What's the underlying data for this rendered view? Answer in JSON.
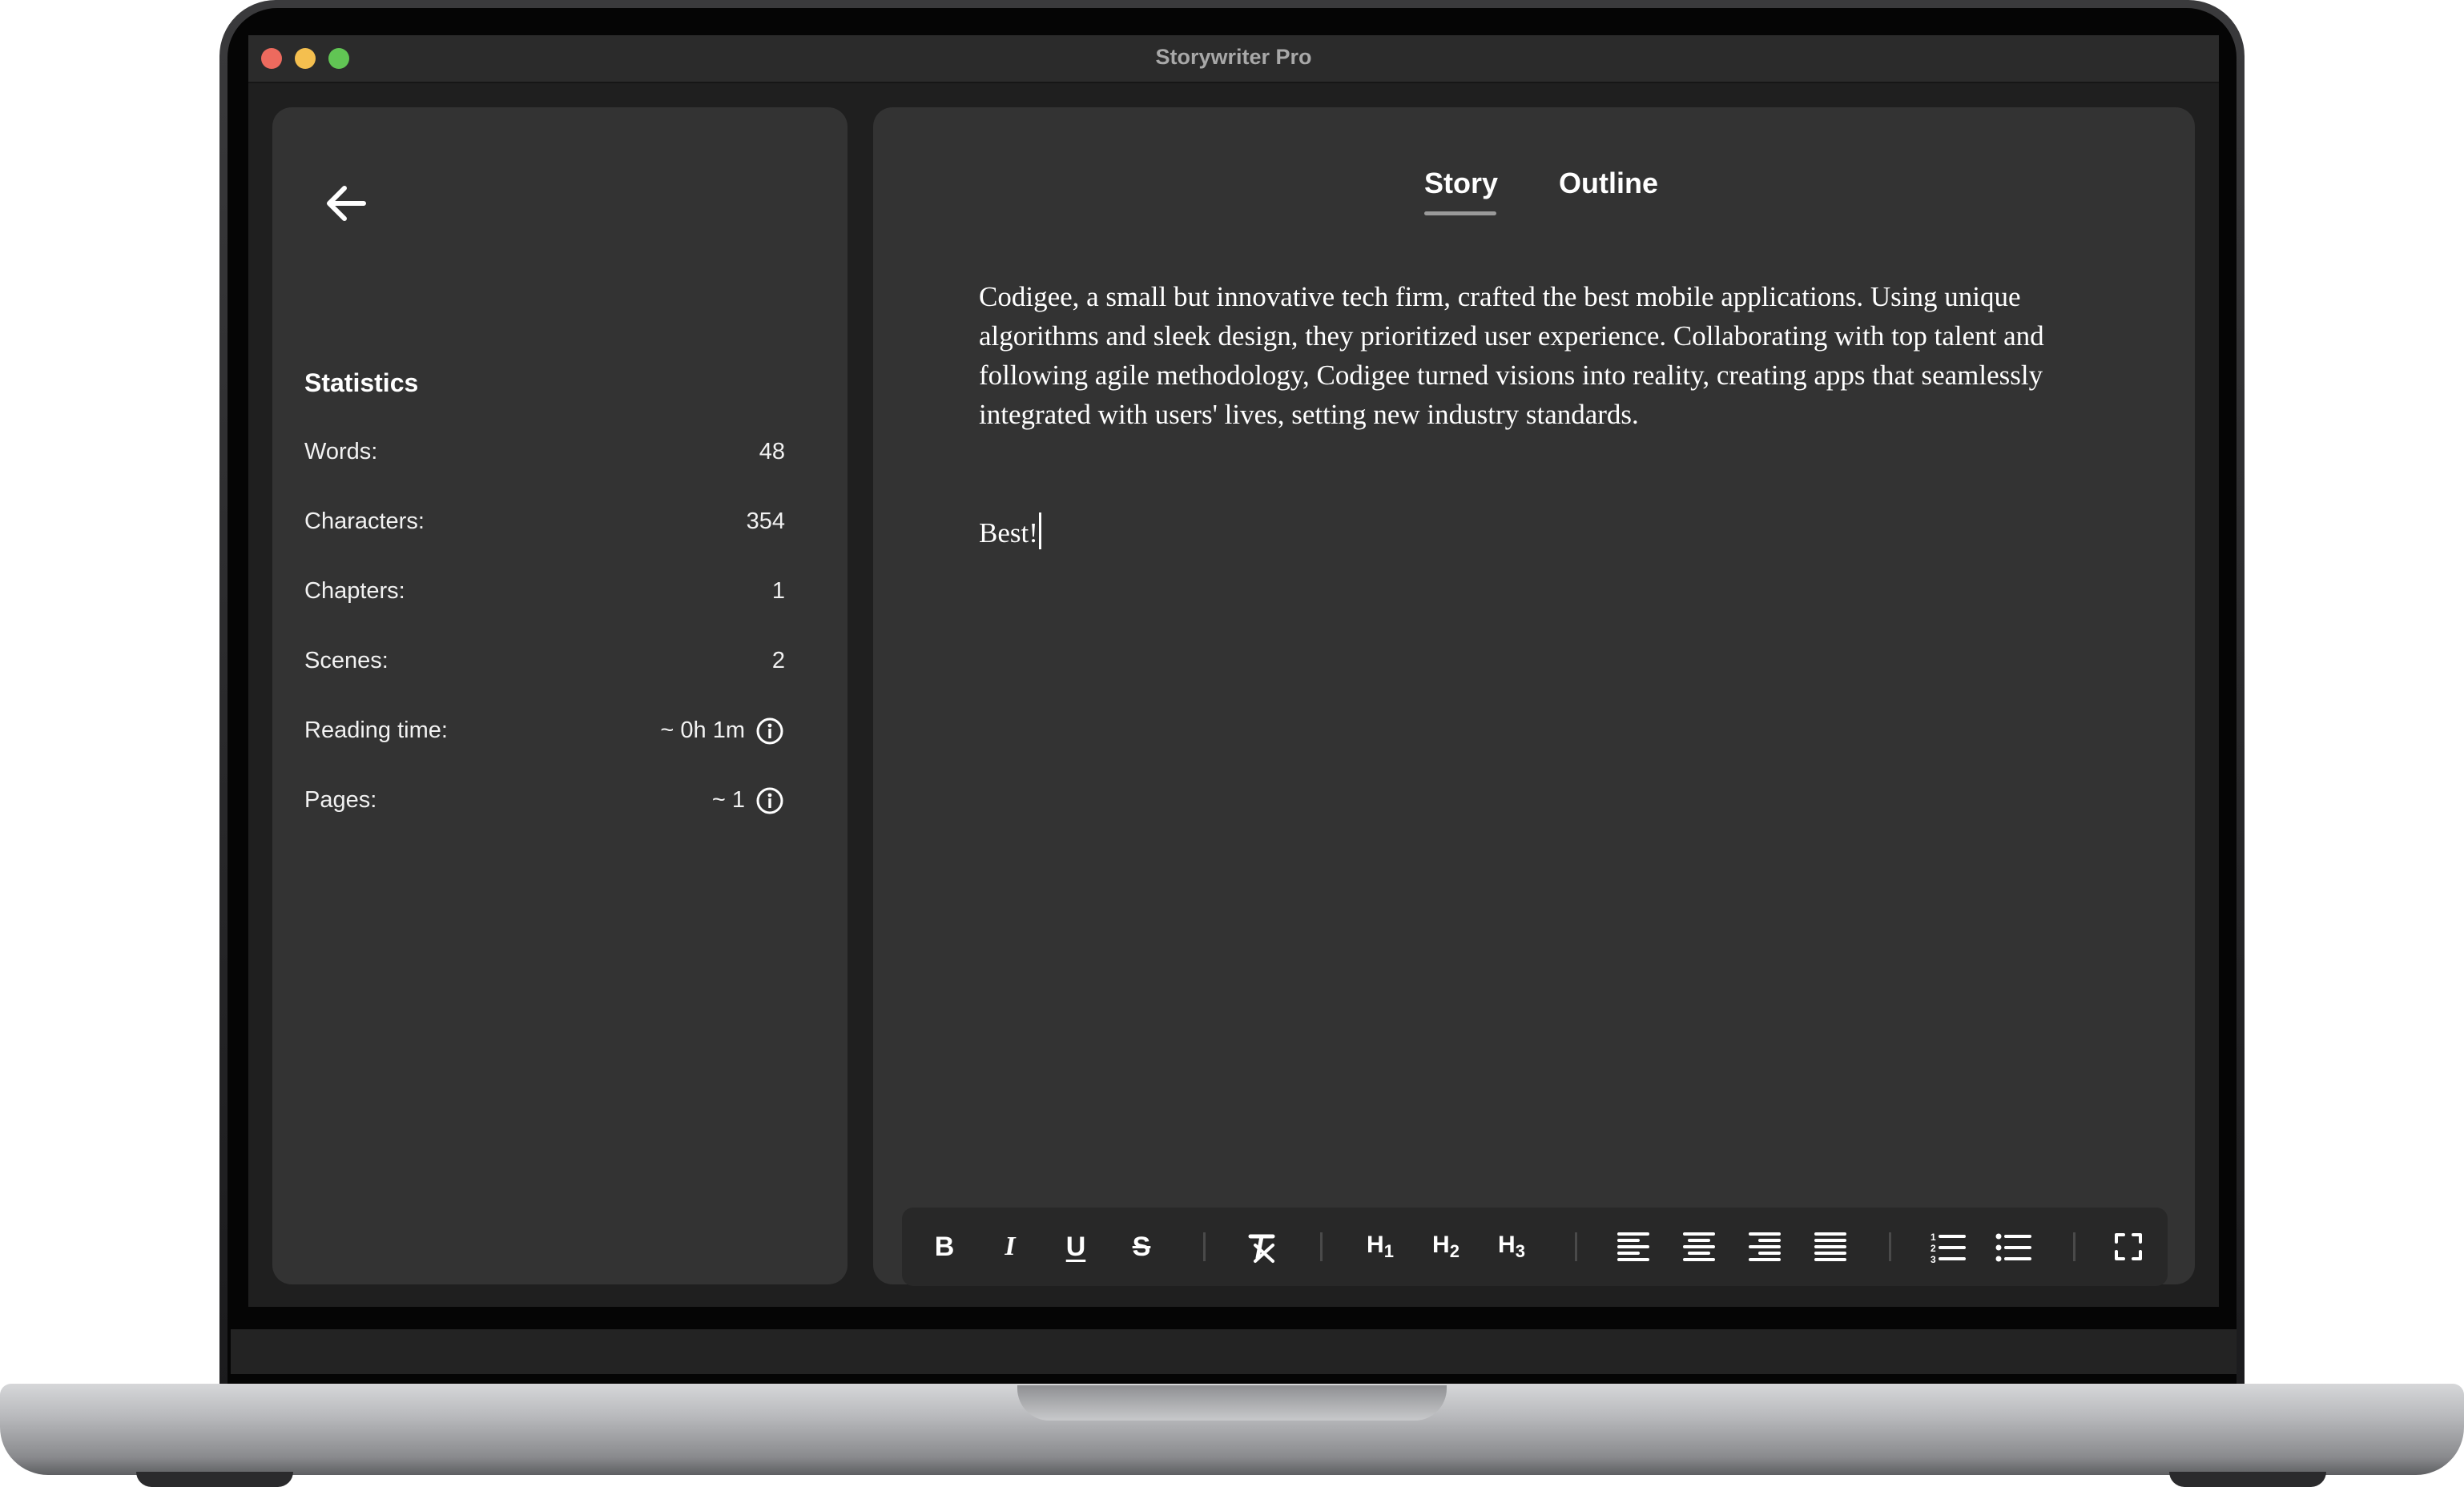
{
  "window": {
    "title": "Storywriter Pro"
  },
  "stats": {
    "heading": "Statistics",
    "rows": [
      {
        "label": "Words:",
        "value": "48"
      },
      {
        "label": "Characters:",
        "value": "354"
      },
      {
        "label": "Chapters:",
        "value": "1"
      },
      {
        "label": "Scenes:",
        "value": "2"
      },
      {
        "label": "Reading time:",
        "value": "~ 0h 1m"
      },
      {
        "label": "Pages:",
        "value": "~ 1"
      }
    ]
  },
  "tabs": [
    {
      "label": "Story",
      "active": true
    },
    {
      "label": "Outline",
      "active": false
    }
  ],
  "story": {
    "paragraph1": "Codigee, a small but innovative tech firm, crafted the best mobile applications. Using unique algorithms and sleek design, they prioritized user experience. Collaborating with top talent and following agile methodology, Codigee turned visions into reality, creating apps that seamlessly integrated with users' lives, setting new industry standards.",
    "paragraph2": "Best!"
  },
  "toolbar": {
    "bold": "B",
    "italic": "I",
    "underline": "U",
    "strike": "S",
    "h1": "H",
    "h1_sub": "1",
    "h2": "H",
    "h2_sub": "2",
    "h3": "H",
    "h3_sub": "3",
    "icons": [
      "bold-icon",
      "italic-icon",
      "underline-icon",
      "strikethrough-icon",
      "clear-format-icon",
      "heading-1-icon",
      "heading-2-icon",
      "heading-3-icon",
      "align-left-icon",
      "align-center-icon",
      "align-right-icon",
      "align-justify-icon",
      "numbered-list-icon",
      "bullet-list-icon",
      "fullscreen-icon"
    ]
  },
  "colors": {
    "panel": "#333333",
    "window": "#1f1f1f",
    "text": "#ffffff"
  }
}
